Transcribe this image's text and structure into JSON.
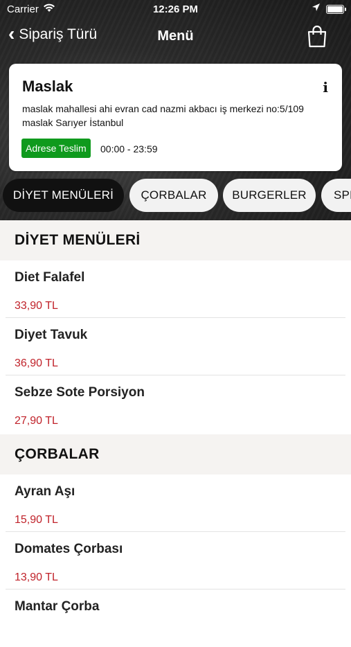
{
  "status_bar": {
    "carrier": "Carrier",
    "time": "12:26 PM"
  },
  "nav": {
    "back_label": "Sipariş Türü",
    "title": "Menü"
  },
  "store": {
    "name": "Maslak",
    "address": "maslak mahallesi ahi evran cad nazmi akbacı iş merkezi no:5/109 maslak Sarıyer İstanbul",
    "delivery_badge": "Adrese Teslim",
    "badge_color": "#0f9a1d",
    "hours": "00:00 - 23:59",
    "info_glyph": "i"
  },
  "tabs": [
    {
      "label": "DİYET MENÜLERİ",
      "active": true
    },
    {
      "label": "ÇORBALAR",
      "active": false
    },
    {
      "label": "BURGERLER",
      "active": false
    },
    {
      "label": "SPE",
      "active": false
    }
  ],
  "sections": [
    {
      "title": "DİYET MENÜLERİ",
      "items": [
        {
          "name": "Diet  Falafel",
          "price": "33,90 TL"
        },
        {
          "name": "Diyet  Tavuk",
          "price": "36,90 TL"
        },
        {
          "name": "Sebze Sote Porsiyon",
          "price": "27,90 TL"
        }
      ]
    },
    {
      "title": "ÇORBALAR",
      "items": [
        {
          "name": "Ayran Aşı",
          "price": "15,90 TL"
        },
        {
          "name": "Domates Çorbası",
          "price": "13,90 TL"
        },
        {
          "name": "Mantar Çorba",
          "price": ""
        }
      ]
    }
  ],
  "colors": {
    "price": "#c0222a",
    "active_tab": "#111111"
  }
}
